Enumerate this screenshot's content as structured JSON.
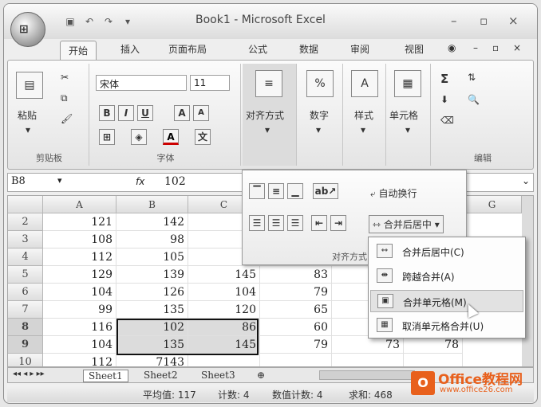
{
  "window": {
    "title": "Book1 - Microsoft Excel",
    "office_button": "Office",
    "controls": [
      "–",
      "▫",
      "×"
    ]
  },
  "ribbon_tabs": [
    "开始",
    "插入",
    "页面布局",
    "公式",
    "数据",
    "审阅",
    "视图"
  ],
  "ribbon": {
    "clipboard": {
      "label": "剪贴板",
      "paste": "粘贴"
    },
    "font": {
      "label": "字体",
      "name": "宋体",
      "size": "11",
      "bold": "B",
      "italic": "I",
      "underline": "U",
      "grow": "A",
      "shrink": "A"
    },
    "alignment": {
      "label": "对齐方式"
    },
    "number": {
      "label": "数字",
      "icon_text": "%"
    },
    "styles": {
      "label": "样式"
    },
    "cells": {
      "label": "单元格"
    },
    "editing": {
      "label": "编辑",
      "sum": "Σ"
    }
  },
  "formula_bar": {
    "name_box": "B8",
    "fx": "fx",
    "value": "102"
  },
  "align_panel": {
    "wrap_text": "自动换行",
    "merge_center": "合并后居中",
    "label": "对齐方式"
  },
  "merge_menu": [
    {
      "label": "合并后居中(C)",
      "hover": false
    },
    {
      "label": "跨越合并(A)",
      "hover": false
    },
    {
      "label": "合并单元格(M)",
      "hover": true
    },
    {
      "label": "取消单元格合并(U)",
      "hover": false
    }
  ],
  "columns": [
    "A",
    "B",
    "C",
    "G"
  ],
  "rows": [
    {
      "num": "2",
      "a": "121",
      "b": "142",
      "c": "1",
      "d": "",
      "e": "",
      "f": "",
      "sel": false
    },
    {
      "num": "3",
      "a": "108",
      "b": "98",
      "c": "1",
      "d": "",
      "e": "",
      "f": "",
      "sel": false
    },
    {
      "num": "4",
      "a": "112",
      "b": "105",
      "c": "1",
      "d": "",
      "e": "",
      "f": "",
      "sel": false
    },
    {
      "num": "5",
      "a": "129",
      "b": "139",
      "c": "145",
      "d": "83",
      "e": "",
      "f": "",
      "sel": false
    },
    {
      "num": "6",
      "a": "104",
      "b": "126",
      "c": "104",
      "d": "79",
      "e": "",
      "f": "",
      "sel": false
    },
    {
      "num": "7",
      "a": "99",
      "b": "135",
      "c": "120",
      "d": "65",
      "e": "",
      "f": "",
      "sel": false
    },
    {
      "num": "8",
      "a": "116",
      "b": "102",
      "c": "86",
      "d": "60",
      "e": "",
      "f": "",
      "sel": true
    },
    {
      "num": "9",
      "a": "104",
      "b": "135",
      "c": "145",
      "d": "79",
      "e": "73",
      "f": "78",
      "sel": true
    },
    {
      "num": "10",
      "a": "112",
      "b": "7143",
      "c": "",
      "d": "",
      "e": "",
      "f": "",
      "sel": false
    }
  ],
  "sheets": [
    "Sheet1",
    "Sheet2",
    "Sheet3"
  ],
  "status": {
    "average": "平均值: 117",
    "count": "计数: 4",
    "numeric_count": "数值计数: 4",
    "sum": "求和: 468"
  },
  "watermark": {
    "logo": "O",
    "title": "Office教程网",
    "url": "www.office26.com"
  }
}
